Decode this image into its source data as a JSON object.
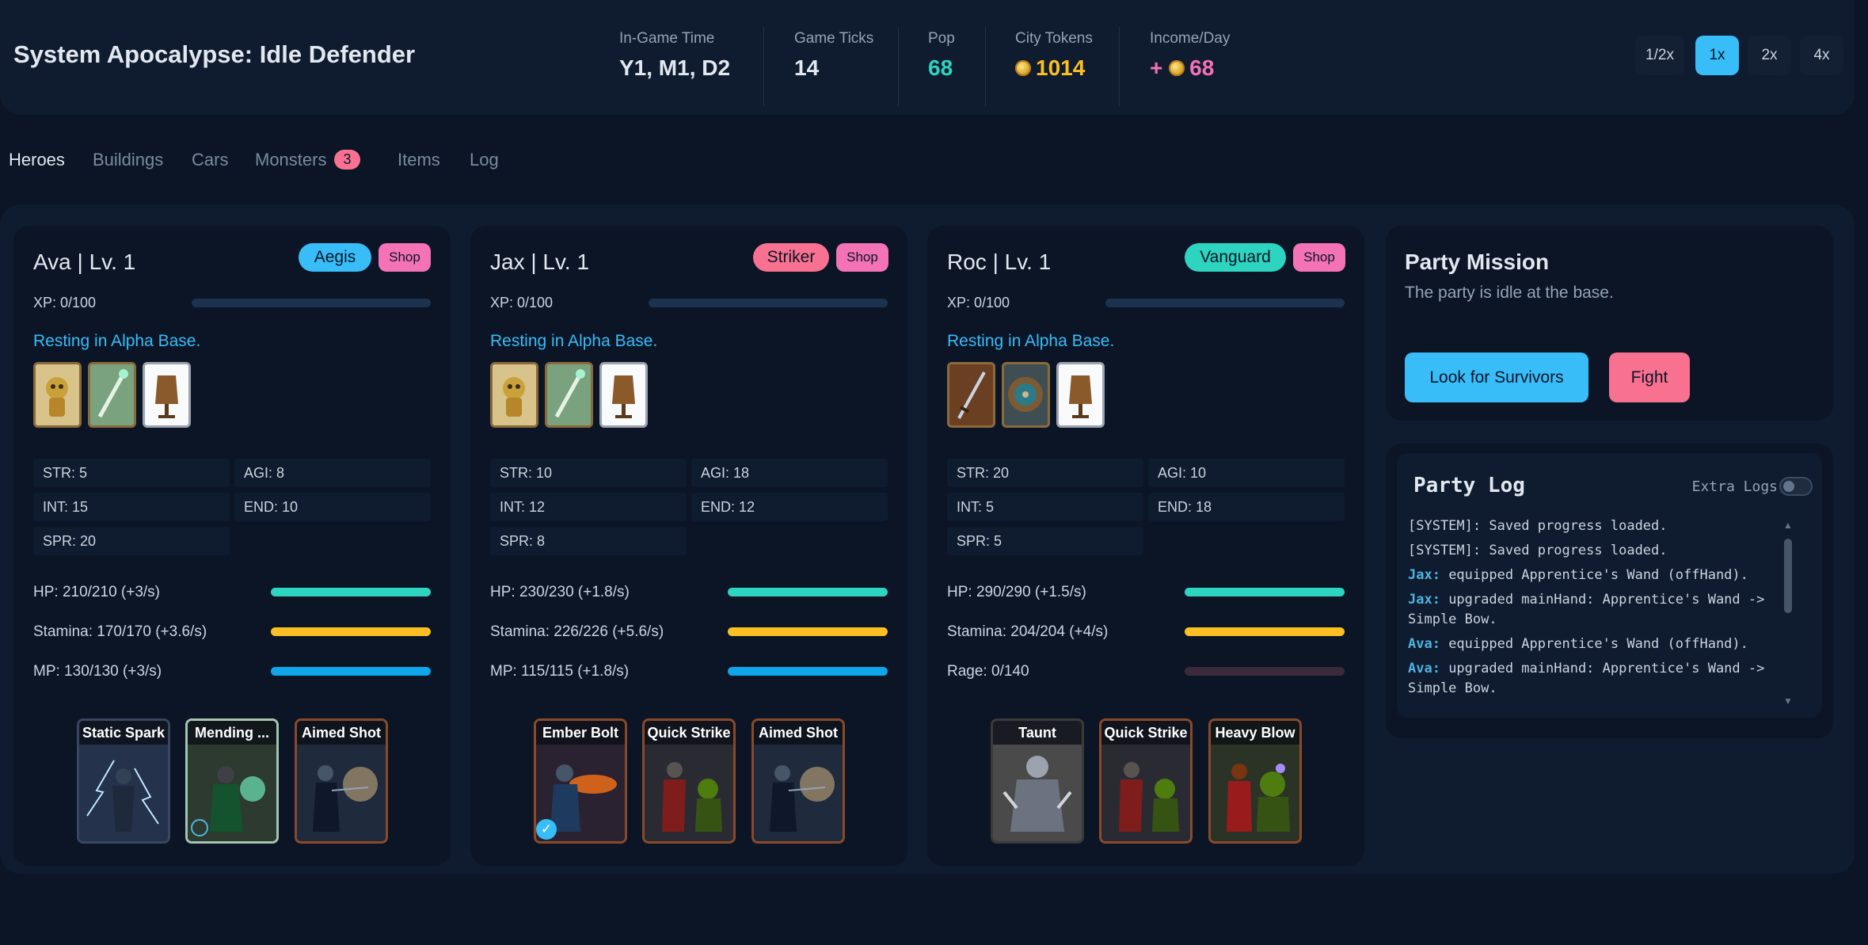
{
  "header": {
    "title": "System Apocalypse: Idle Defender",
    "stats": [
      {
        "label": "In-Game Time",
        "value": "Y1, M1, D2",
        "color": "#e2e8f0"
      },
      {
        "label": "Game Ticks",
        "value": "14",
        "color": "#e2e8f0"
      },
      {
        "label": "Pop",
        "value": "68",
        "color": "#2dd4bf"
      },
      {
        "label": "City Tokens",
        "value": "1014",
        "color": "#fbbf24"
      },
      {
        "label": "Income/Day",
        "prefix": "+",
        "value": "68",
        "color": "#f472b6"
      }
    ],
    "speeds": [
      "1/2x",
      "1x",
      "2x",
      "4x"
    ],
    "active_speed": "1x"
  },
  "tabs": [
    {
      "label": "Heroes",
      "active": true
    },
    {
      "label": "Buildings"
    },
    {
      "label": "Cars"
    },
    {
      "label": "Monsters",
      "badge": "3"
    },
    {
      "label": "Items"
    },
    {
      "label": "Log"
    }
  ],
  "heroes": [
    {
      "name": "Ava | Lv. 1",
      "class": "Aegis",
      "class_color": "#38bdf8",
      "shop": "Shop",
      "xp": "XP: 0/100",
      "status": "Resting in Alpha Base.",
      "equipment": [
        "wand-item",
        "wand-item",
        "cloth-armor-item"
      ],
      "attrs": [
        "STR: 5",
        "AGI: 8",
        "INT: 15",
        "END: 10",
        "SPR: 20"
      ],
      "resources": [
        {
          "label": "HP: 210/210 (+3/s)",
          "color": "#2dd4bf",
          "fill": 1
        },
        {
          "label": "Stamina: 170/170 (+3.6/s)",
          "color": "#fbbf24",
          "fill": 1
        },
        {
          "label": "MP: 130/130 (+3/s)",
          "color": "#38bdf8",
          "fill": 1
        }
      ],
      "abilities": [
        "Static Spark",
        "Mending ...",
        "Aimed Shot"
      ]
    },
    {
      "name": "Jax | Lv. 1",
      "class": "Striker",
      "class_color": "#f87191",
      "shop": "Shop",
      "xp": "XP: 0/100",
      "status": "Resting in Alpha Base.",
      "equipment": [
        "wand-item",
        "wand-item",
        "cloth-armor-item"
      ],
      "attrs": [
        "STR: 10",
        "AGI: 18",
        "INT: 12",
        "END: 12",
        "SPR: 8"
      ],
      "resources": [
        {
          "label": "HP: 230/230 (+1.8/s)",
          "color": "#2dd4bf",
          "fill": 1
        },
        {
          "label": "Stamina: 226/226 (+5.6/s)",
          "color": "#fbbf24",
          "fill": 1
        },
        {
          "label": "MP: 115/115 (+1.8/s)",
          "color": "#38bdf8",
          "fill": 1
        }
      ],
      "abilities": [
        "Ember Bolt",
        "Quick Strike",
        "Aimed Shot"
      ]
    },
    {
      "name": "Roc | Lv. 1",
      "class": "Vanguard",
      "class_color": "#2dd4bf",
      "shop": "Shop",
      "xp": "XP: 0/100",
      "status": "Resting in Alpha Base.",
      "equipment": [
        "sword-item",
        "shield-item",
        "cloth-armor-item"
      ],
      "attrs": [
        "STR: 20",
        "AGI: 10",
        "INT: 5",
        "END: 18",
        "SPR: 5"
      ],
      "resources": [
        {
          "label": "HP: 290/290 (+1.5/s)",
          "color": "#2dd4bf",
          "fill": 1
        },
        {
          "label": "Stamina: 204/204 (+4/s)",
          "color": "#fbbf24",
          "fill": 1
        },
        {
          "label": "Rage: 0/140",
          "color": "#3b2a3a",
          "fill": 0
        }
      ],
      "abilities": [
        "Taunt",
        "Quick Strike",
        "Heavy Blow"
      ]
    }
  ],
  "mission": {
    "title": "Party Mission",
    "text": "The party is idle at the base.",
    "survivors_btn": "Look for Survivors",
    "fight_btn": "Fight"
  },
  "party_log": {
    "title": "Party Log",
    "extra_logs": "Extra Logs",
    "lines": [
      {
        "who": "",
        "text": "[SYSTEM]: Saved progress loaded."
      },
      {
        "who": "",
        "text": "[SYSTEM]: Saved progress loaded."
      },
      {
        "who": "Jax:",
        "text": " equipped Apprentice's Wand (offHand)."
      },
      {
        "who": "Jax:",
        "text": " upgraded mainHand: Apprentice's Wand -> Simple Bow."
      },
      {
        "who": "Ava:",
        "text": " equipped Apprentice's Wand (offHand)."
      },
      {
        "who": "Ava:",
        "text": " upgraded mainHand: Apprentice's Wand -> Simple Bow."
      }
    ]
  }
}
